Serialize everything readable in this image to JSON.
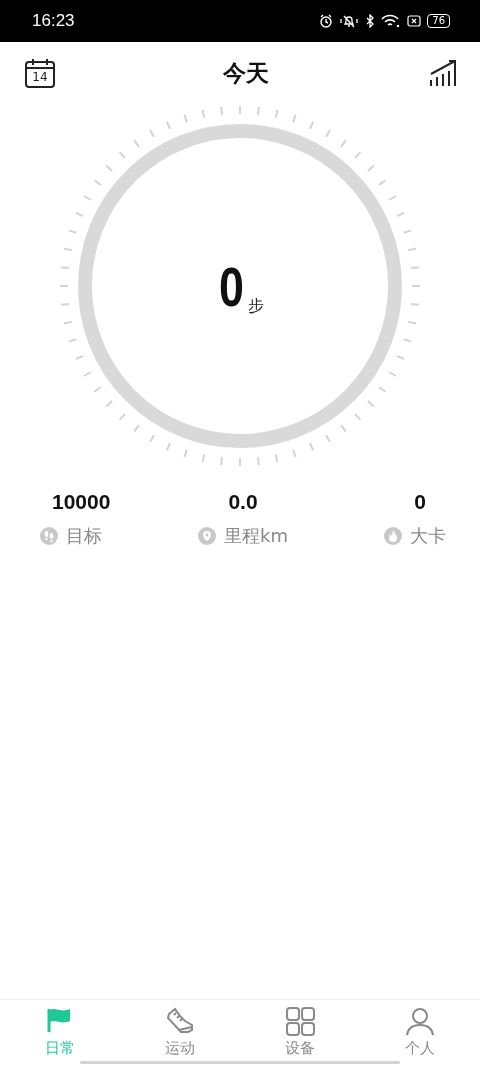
{
  "status_bar": {
    "time": "16:23",
    "battery": "76"
  },
  "header": {
    "calendar_day": "14",
    "title": "今天"
  },
  "steps": {
    "value": "0",
    "unit": "步",
    "level": 0
  },
  "stats": [
    {
      "kind": "goal",
      "value": "10000",
      "label": "目标"
    },
    {
      "kind": "distance",
      "value": "0.0",
      "label": "里程km"
    },
    {
      "kind": "calories",
      "value": "0",
      "label": "大卡"
    }
  ],
  "tabs": [
    {
      "kind": "daily",
      "label": "日常",
      "selected": true
    },
    {
      "kind": "sport",
      "label": "运动",
      "selected": false
    },
    {
      "kind": "device",
      "label": "设备",
      "selected": false
    },
    {
      "kind": "profile",
      "label": "个人",
      "selected": false
    }
  ]
}
